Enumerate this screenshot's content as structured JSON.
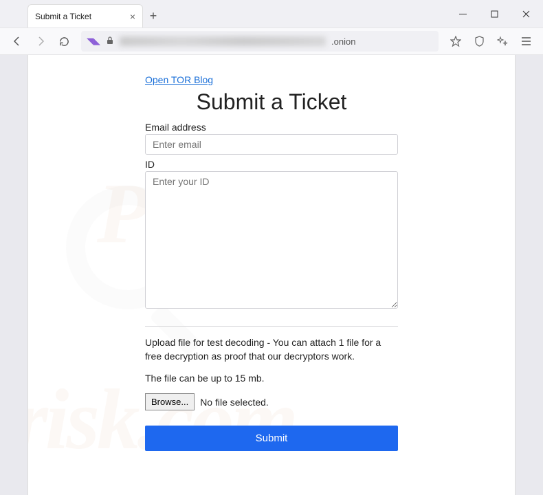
{
  "window": {
    "tab_title": "Submit a Ticket",
    "url_suffix": ".onion"
  },
  "page": {
    "top_link": "Open TOR Blog",
    "heading": "Submit a Ticket",
    "email_label": "Email address",
    "email_placeholder": "Enter email",
    "id_label": "ID",
    "id_placeholder": "Enter your ID",
    "upload_desc": "Upload file for test decoding - You can attach 1 file for a free decryption as proof that our decryptors work.",
    "file_limit_text": "The file can be up to 15 mb.",
    "browse_label": "Browse...",
    "file_status": "No file selected.",
    "submit_label": "Submit"
  },
  "watermark": {
    "text1": "PCrisk",
    "text2": "risk.com"
  }
}
